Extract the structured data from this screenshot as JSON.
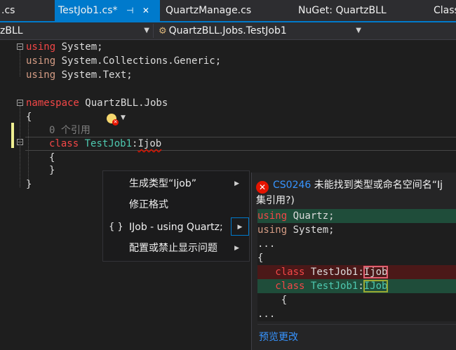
{
  "tabs": [
    {
      "label": ".cs"
    },
    {
      "label": "TestJob1.cs*",
      "pin": "⊣",
      "close": "✕"
    },
    {
      "label": "QuartzManage.cs"
    },
    {
      "label": "NuGet: QuartzBLL"
    },
    {
      "label": "Class"
    }
  ],
  "nav": {
    "project": "zBLL",
    "member": "QuartzBLL.Jobs.TestJob1"
  },
  "code": {
    "l1_kw": "using",
    "l1_ns": " System;",
    "l2_kw": "using",
    "l2_ns": " System.Collections.Generic;",
    "l3_kw": "using",
    "l3_ns": " System.Text;",
    "l5_kw": "namespace",
    "l5_ns": " QuartzBLL.Jobs",
    "l6": "{",
    "l7": "0 个引用",
    "l8_kw": "class",
    "l8_type": "TestJob1",
    "l8_colon": ":",
    "l8_base": "Ijob",
    "l9": "{",
    "l10": "}",
    "l11": "}"
  },
  "menu": {
    "items": [
      {
        "label": "生成类型“Ijob”"
      },
      {
        "label": "修正格式"
      },
      {
        "brace": "{ }",
        "label": "IJob - using Quartz;"
      },
      {
        "label": "配置或禁止显示问题"
      }
    ]
  },
  "preview": {
    "error_code": "CS0246",
    "error_msg_1": "未能找到类型或命名空间名“Ij",
    "error_msg_2": "集引用?)",
    "lines": {
      "a_kw": "using",
      "a_ns": " Quartz;",
      "b_kw": "using",
      "b_ns": " System;",
      "c": "...",
      "d": "{",
      "e_kw": "class",
      "e_type": "TestJob1",
      "e_colon": ":",
      "e_base": "Ijob",
      "f_kw": "class",
      "f_type": "TestJob1",
      "f_colon": ":",
      "f_base": "IJob",
      "g": "{",
      "h": "..."
    },
    "link": "预览更改"
  },
  "colors": {
    "accent": "#007acc",
    "keyword": "#569cd6",
    "type": "#4ec9b0",
    "error": "#e51400"
  }
}
